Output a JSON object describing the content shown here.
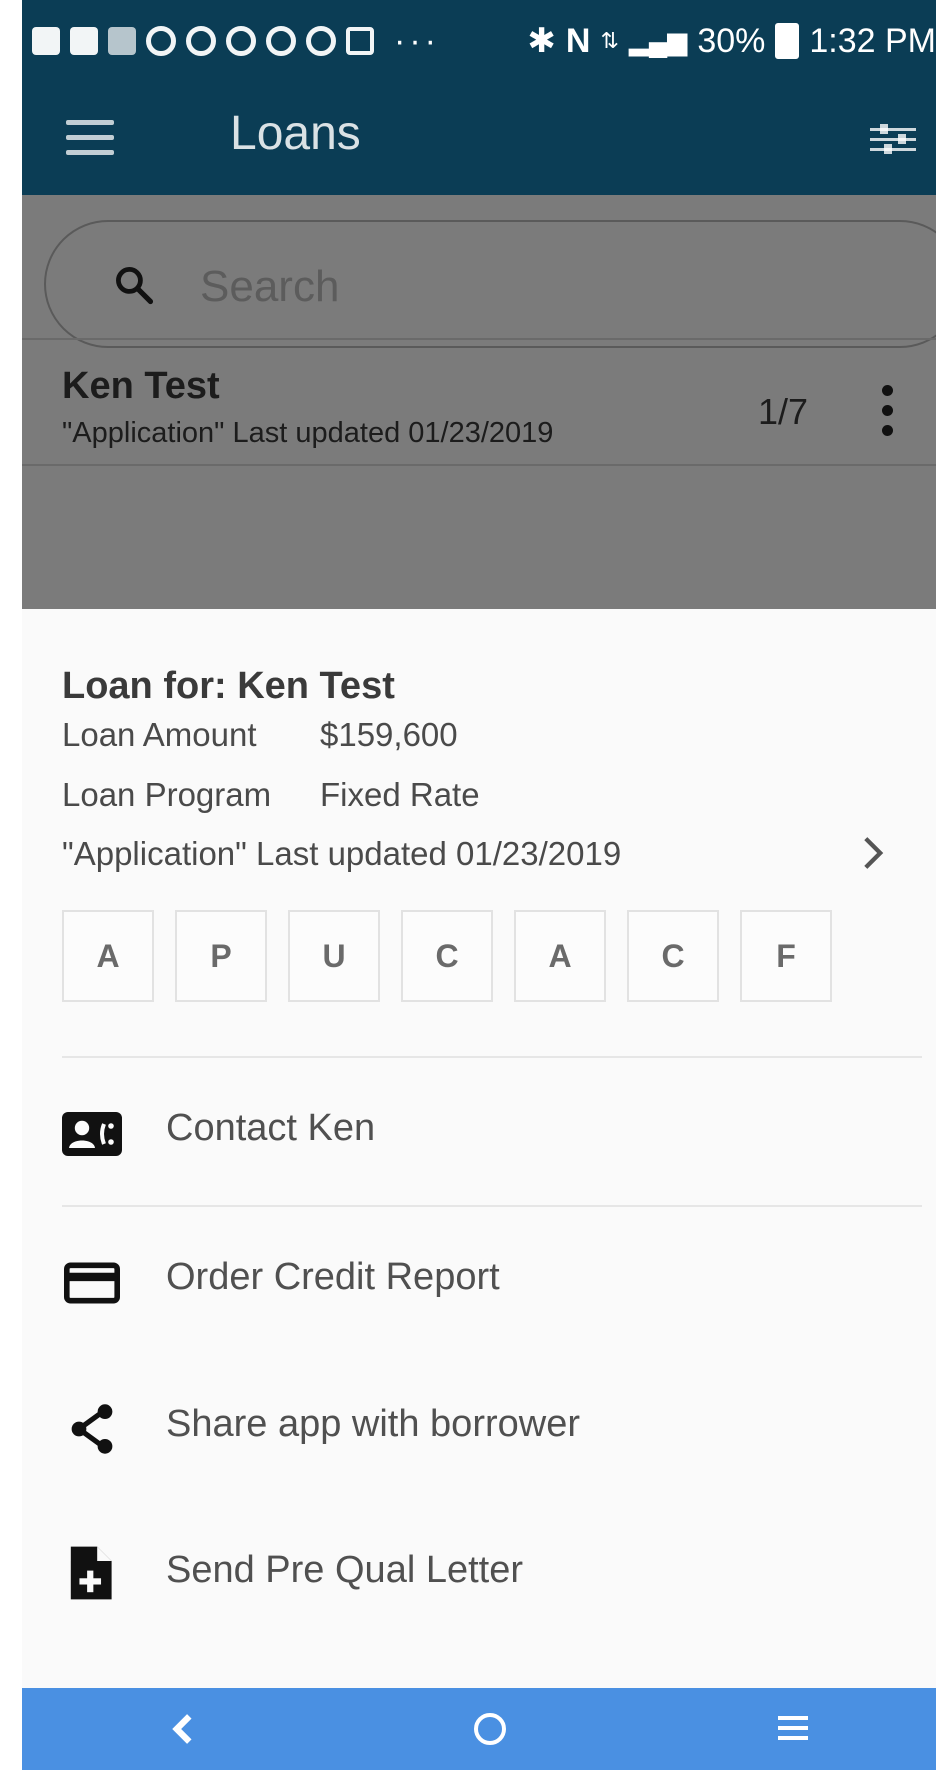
{
  "status_bar": {
    "dots": "···",
    "battery": "30%",
    "time": "1:32 PM"
  },
  "app_bar": {
    "title": "Loans"
  },
  "search": {
    "placeholder": "Search"
  },
  "loan_row": {
    "name": "Ken Test",
    "status": "\"Application\" Last updated 01/23/2019",
    "count": "1/7"
  },
  "sheet": {
    "title": "Loan for: Ken Test",
    "amount_label": "Loan Amount",
    "amount_value": "$159,600",
    "program_label": "Loan Program",
    "program_value": "Fixed Rate",
    "status": "\"Application\" Last updated 01/23/2019",
    "steps": [
      "A",
      "P",
      "U",
      "C",
      "A",
      "C",
      "F"
    ],
    "actions": [
      {
        "label": "Contact Ken",
        "icon": "contact-card-icon"
      },
      {
        "label": "Order Credit Report",
        "icon": "credit-card-icon"
      },
      {
        "label": "Share app with borrower",
        "icon": "share-icon"
      },
      {
        "label": "Send Pre Qual Letter",
        "icon": "note-add-icon"
      }
    ]
  },
  "nav_bar": {
    "background": "#4a90e2"
  },
  "colors": {
    "app_bar": "#0b3d55",
    "scrim": "#7b7b7b",
    "sheet": "#fafafa"
  }
}
